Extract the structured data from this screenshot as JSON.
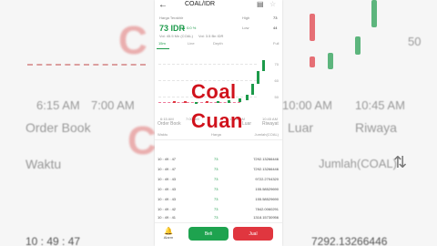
{
  "backdrop": {
    "times": [
      "6:15 AM",
      "7:00 AM",
      "10:00 AM",
      "10:45 AM"
    ],
    "order_book_label": "Order Book",
    "luar_label": "Luar",
    "riwayat_label": "Riwaya",
    "waktu_label": "Waktu",
    "jumlah_label": "Jumlah(COAL)",
    "bottom_time": "10 : 49 : 47",
    "bottom_amount": "7292.13266446",
    "ylabel_50": "50"
  },
  "header": {
    "ticker": "COAL/IDR",
    "back_icon": "back-arrow-icon",
    "notify_icon": "notes-icon",
    "star_icon": "star-icon"
  },
  "market": {
    "last_price_label": "Harga Terakhir",
    "price": "73 IDR",
    "change": "▲ 0.0 %",
    "vol1": "Vol: 45.5 Mn (COAL)",
    "vol2": "Vol: 3.5 Bn IDR",
    "high_label": "High",
    "high_value": "73",
    "low_label": "Low",
    "low_value": "44"
  },
  "chart_tabs": [
    "15m",
    "Line",
    "Depth",
    "Full"
  ],
  "chart": {
    "ylabels": [
      "70",
      "60",
      "50"
    ],
    "xlabels": [
      "6:15 AM",
      "7:00 AM",
      "10:00 AM",
      "10:45 AM"
    ]
  },
  "overlay": {
    "line1": "Coal",
    "line2": "Cuan"
  },
  "order_tabs": [
    "Order Book",
    "Luar",
    "Riwayat"
  ],
  "table": {
    "headers": [
      "Waktu",
      "Harga",
      "Jumlah(COAL)"
    ],
    "rows": [
      {
        "time": "10 : 49 : 47",
        "price": "73",
        "amount": "7292.13266446"
      },
      {
        "time": "10 : 49 : 47",
        "price": "73",
        "amount": "7292.13266446"
      },
      {
        "time": "10 : 49 : 43",
        "price": "73",
        "amount": "9722.2704320"
      },
      {
        "time": "10 : 49 : 43",
        "price": "73",
        "amount": "155.58529690"
      },
      {
        "time": "10 : 49 : 43",
        "price": "73",
        "amount": "155.58529690"
      },
      {
        "time": "10 : 49 : 42",
        "price": "73",
        "amount": "7842.0060291"
      },
      {
        "time": "10 : 49 : 41",
        "price": "73",
        "amount": "1318.15730956"
      }
    ]
  },
  "actions": {
    "alarm_label": "Alarm",
    "buy_label": "Beli",
    "sell_label": "Jual"
  },
  "colors": {
    "up": "#1c9a4a",
    "down": "#e0363f",
    "overlay": "#d0121c"
  }
}
